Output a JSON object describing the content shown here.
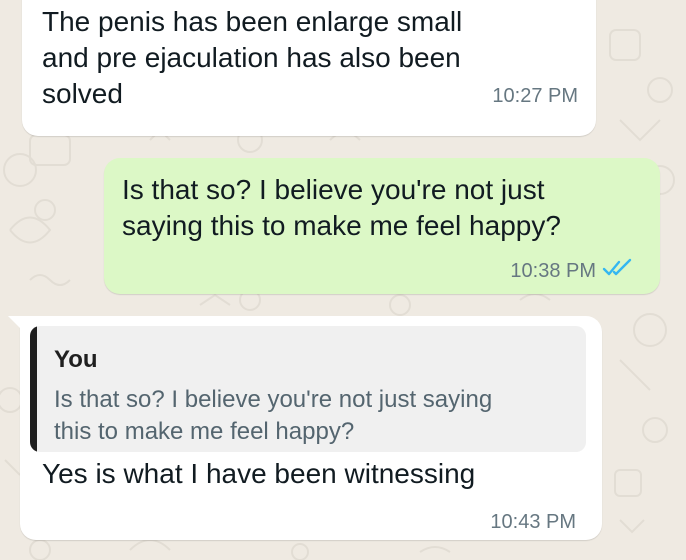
{
  "colors": {
    "background": "#efeae2",
    "incoming_bubble": "#ffffff",
    "outgoing_bubble": "#dcf8c6",
    "text": "#111b21",
    "meta_text": "#667781",
    "read_ticks": "#34b7f1",
    "quote_background": "#f0f0f0",
    "quote_bar": "#1f1f1f"
  },
  "messages": [
    {
      "direction": "incoming",
      "text": "The penis has been enlarge small\nand pre ejaculation has also been\nsolved",
      "time": "10:27 PM"
    },
    {
      "direction": "outgoing",
      "text": "Is that so? I believe you're not just\nsaying this to make me feel happy?",
      "time": "10:38 PM",
      "status_icon": "double-check-read-icon"
    },
    {
      "direction": "incoming",
      "quote": {
        "author": "You",
        "text": "Is that so? I believe you're not just saying\nthis to make me feel happy?"
      },
      "text": "Yes is what I have been witnessing",
      "time": "10:43 PM"
    }
  ]
}
